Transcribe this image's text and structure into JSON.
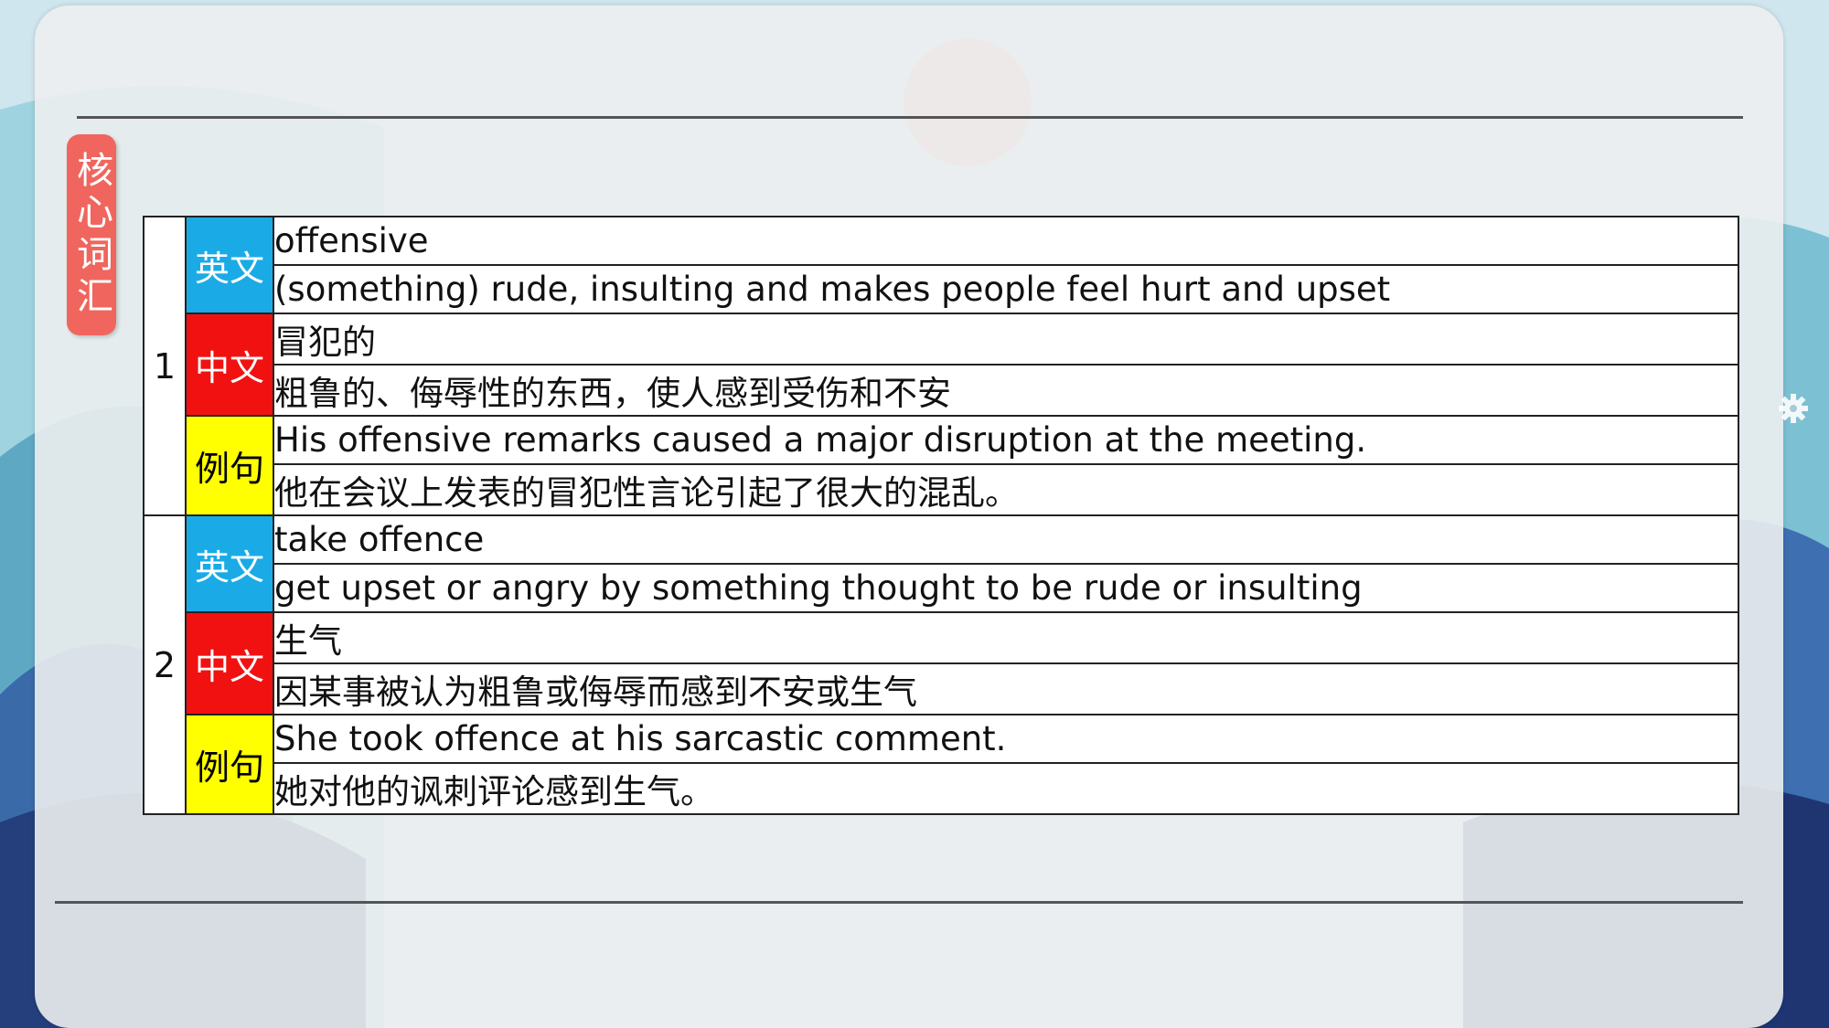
{
  "badge": {
    "label": "核心词汇"
  },
  "entries": [
    {
      "number": "1",
      "english_label": "英文",
      "chinese_label": "中文",
      "example_label": "例句",
      "term": "offensive",
      "definition": "(something) rude, insulting and makes people feel hurt and upset",
      "chinese_term": "冒犯的",
      "chinese_definition": "粗鲁的、侮辱性的东西，使人感到受伤和不安",
      "example_en": "His offensive remarks caused a major disruption at the meeting.",
      "example_zh": "他在会议上发表的冒犯性言论引起了很大的混乱。"
    },
    {
      "number": "2",
      "english_label": "英文",
      "chinese_label": "中文",
      "example_label": "例句",
      "term": "take offence",
      "definition": "get upset or angry by something thought to be rude or insulting",
      "chinese_term": "生气",
      "chinese_definition": "因某事被认为粗鲁或侮辱而感到不安或生气",
      "example_en": "She took offence at his sarcastic comment.",
      "example_zh": "她对他的讽刺评论感到生气。"
    }
  ],
  "colors": {
    "english_label_bg": "#1aabe6",
    "chinese_label_bg": "#f21111",
    "example_label_bg": "#ffff00",
    "badge_bg": "#f0655d"
  },
  "icons": [
    "gear-icon"
  ]
}
